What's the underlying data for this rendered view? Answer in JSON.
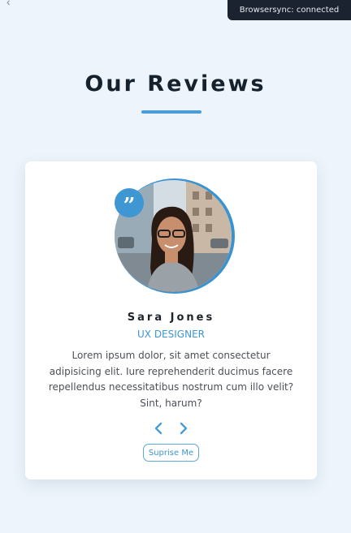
{
  "toast": {
    "text": "Browsersync: connected"
  },
  "header": {
    "title": "Our Reviews"
  },
  "review": {
    "name": "Sara Jones",
    "role": "UX DESIGNER",
    "text": "Lorem ipsum dolor, sit amet consectetur adipisicing elit. Iure reprehenderit ducimus facere repellendus necessitatibus nostrum cum illo velit? Sint, harum?"
  },
  "controls": {
    "prev_icon": "chevron-left-icon",
    "next_icon": "chevron-right-icon",
    "surprise_label": "Suprise Me"
  },
  "colors": {
    "background": "#edf4fb",
    "accent": "#3e96d3",
    "title": "#15222e",
    "card": "#ffffff"
  }
}
